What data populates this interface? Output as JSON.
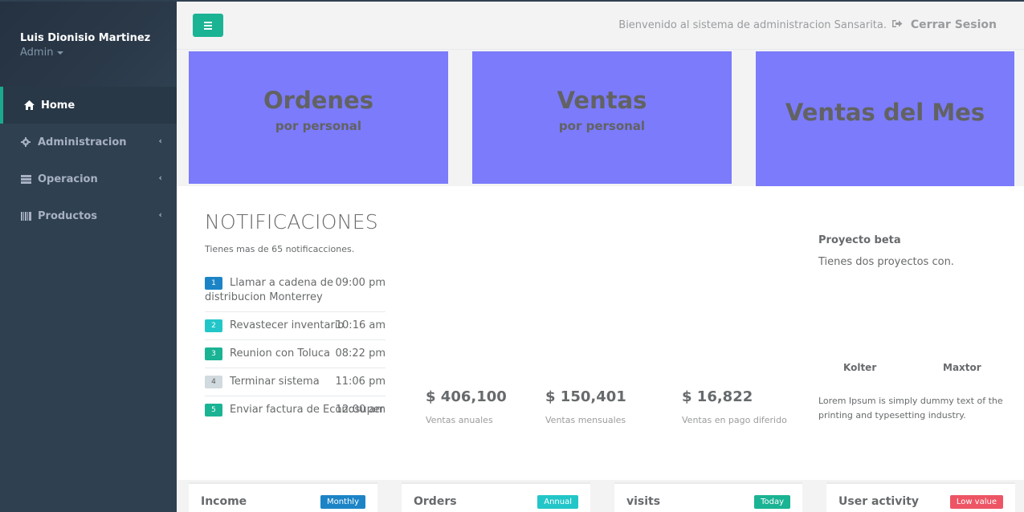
{
  "profile": {
    "name": "Luis Dionisio Martinez",
    "role": "Admin"
  },
  "nav": [
    {
      "label": "Home",
      "icon": "home-icon",
      "active": true
    },
    {
      "label": "Administracion",
      "icon": "gear-icon",
      "active": false
    },
    {
      "label": "Operacion",
      "icon": "list-icon",
      "active": false
    },
    {
      "label": "Productos",
      "icon": "barcode-icon",
      "active": false
    }
  ],
  "header": {
    "welcome": "Bienvenido al sistema de administracion Sansarita.",
    "logout_label": "Cerrar Sesion"
  },
  "cards": [
    {
      "title": "Ordenes",
      "subtitle": "por personal"
    },
    {
      "title": "Ventas",
      "subtitle": "por personal"
    },
    {
      "title": "Ventas del Mes"
    }
  ],
  "notifications": {
    "title": "NOTIFICACIONES",
    "subtitle": "Tienes mas de 65 notificacciones.",
    "items": [
      {
        "num": "1",
        "text": "Llamar a cadena de distribucion Monterrey",
        "time": "09:00 pm",
        "color": "#1c84c6"
      },
      {
        "num": "2",
        "text": "Revastecer inventario",
        "time": "10:16 am",
        "color": "#23c6c8"
      },
      {
        "num": "3",
        "text": "Reunion con Toluca",
        "time": "08:22 pm",
        "color": "#1ab394"
      },
      {
        "num": "4",
        "text": "Terminar sistema",
        "time": "11:06 pm",
        "color": "#d1dade"
      },
      {
        "num": "5",
        "text": "Enviar factura de Econosuper",
        "time": "12:00 am",
        "color": "#1ab394"
      }
    ]
  },
  "stats": [
    {
      "value": "$ 406,100",
      "label": "Ventas anuales"
    },
    {
      "value": "$ 150,401",
      "label": "Ventas mensuales"
    },
    {
      "value": "$ 16,822",
      "label": "Ventas en pago diferido"
    }
  ],
  "project": {
    "title": "Proyecto beta",
    "subtitle": "Tienes dos proyectos con.",
    "labels": [
      "Kolter",
      "Maxtor"
    ],
    "description": "Lorem Ipsum is simply dummy text of the printing and typesetting industry."
  },
  "widgets": [
    {
      "title": "Income",
      "label": "Monthly",
      "color": "#1c84c6"
    },
    {
      "title": "Orders",
      "label": "Annual",
      "color": "#23c6c8"
    },
    {
      "title": "visits",
      "label": "Today",
      "color": "#1ab394"
    },
    {
      "title": "User activity",
      "label": "Low value",
      "color": "#ed5565"
    }
  ]
}
